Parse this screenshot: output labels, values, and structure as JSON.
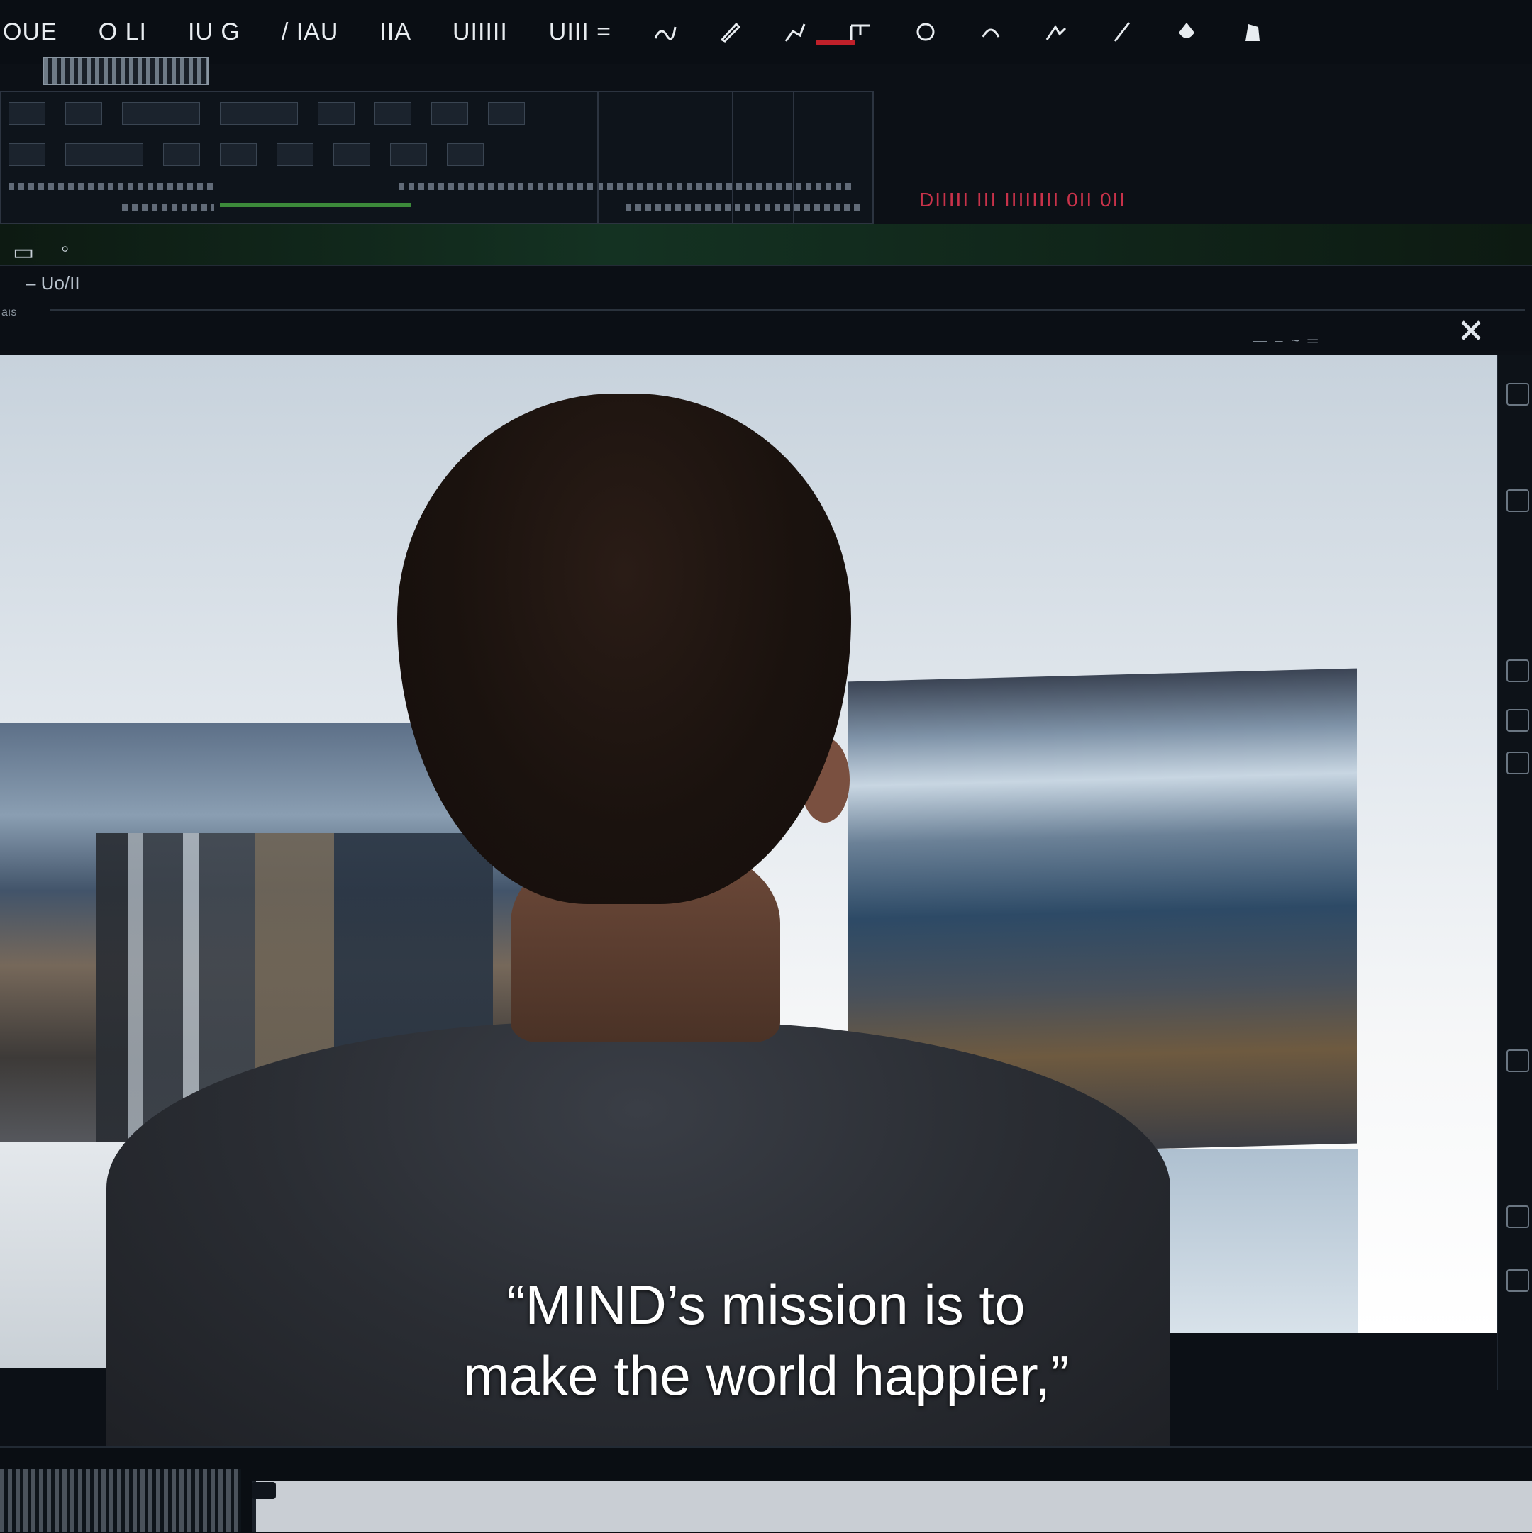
{
  "window": {
    "menu_items": [
      "OUE",
      "O LI",
      "IU G",
      "/ IAU",
      "IIA",
      "UIIIII",
      "UIII ="
    ],
    "menu_icons": [
      "edit-icon",
      "pen-icon",
      "brush-icon",
      "layer-icon",
      "transform-icon",
      "shape-icon",
      "select-icon",
      "picker-icon",
      "fill-icon",
      "lock-icon"
    ]
  },
  "ribbon": {
    "status_text": "DIIIII III IIIIIIII 0II 0II"
  },
  "sub_toolbar": {
    "label": "– Uo/II",
    "small_label": "aıs"
  },
  "subtitle": {
    "line1": "“MIND’s mission is to",
    "line2": "make the world happier,”"
  },
  "colors": {
    "accent_red": "#c0202a",
    "status_red": "#c8324a",
    "timeline_green": "#3c8a3a"
  }
}
